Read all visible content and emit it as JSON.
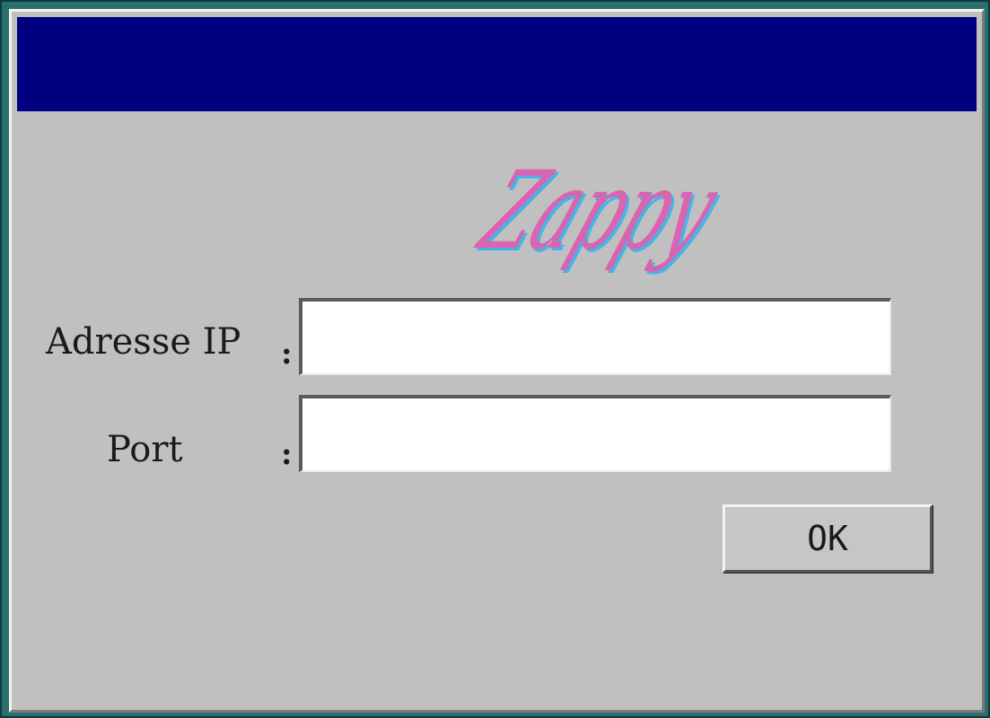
{
  "app": {
    "logo_text": "Zappy"
  },
  "form": {
    "ip_label": "Adresse IP",
    "port_label": "Port",
    "separator": ":",
    "ip_value": "",
    "port_value": "",
    "ok_label": "OK"
  },
  "colors": {
    "titlebar": "#000080",
    "window_bg": "#c0c0c0",
    "desktop": "#2a6e6e",
    "logo_pink": "#d964b0",
    "logo_cyan": "#46b4e6"
  }
}
